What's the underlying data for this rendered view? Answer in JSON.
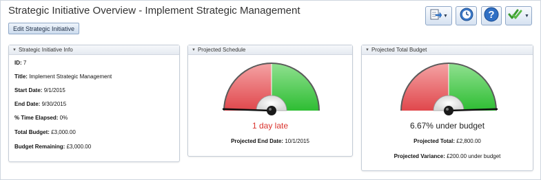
{
  "page": {
    "title": "Strategic Initiative Overview - Implement Strategic Management",
    "edit_button": "Edit Strategic Initiative"
  },
  "toolbar": {
    "buttons": [
      {
        "icon": "export-icon",
        "has_dropdown": true
      },
      {
        "icon": "history-icon",
        "has_dropdown": false
      },
      {
        "icon": "help-icon",
        "has_dropdown": false
      },
      {
        "icon": "approve-icon",
        "has_dropdown": true
      }
    ]
  },
  "info_panel": {
    "title": "Strategic Initiative Info",
    "fields": [
      {
        "label": "ID:",
        "value": "7"
      },
      {
        "label": "Title:",
        "value": "Implement Strategic Management"
      },
      {
        "label": "Start Date:",
        "value": "9/1/2015"
      },
      {
        "label": "End Date:",
        "value": "9/30/2015"
      },
      {
        "label": "% Time Elapsed:",
        "value": "0%"
      },
      {
        "label": "Total Budget:",
        "value": "£3,000.00"
      },
      {
        "label": "Budget Remaining:",
        "value": "£3,000.00"
      }
    ]
  },
  "schedule_panel": {
    "title": "Projected Schedule",
    "status": "1 day late",
    "status_color": "#d9312b",
    "needle_fraction": 0.01,
    "details": [
      {
        "label": "Projected End Date:",
        "value": "10/1/2015"
      }
    ]
  },
  "budget_panel": {
    "title": "Projected Total Budget",
    "status": "6.67% under budget",
    "status_color": "#222222",
    "needle_fraction": 0.99,
    "details": [
      {
        "label": "Projected Total:",
        "value": "£2,800.00"
      },
      {
        "label": "Projected Variance:",
        "value": "£200.00 under budget"
      }
    ]
  },
  "colors": {
    "gauge_red": "#e0474c",
    "gauge_green": "#2ebd33",
    "accent": "#8ea7c7"
  }
}
